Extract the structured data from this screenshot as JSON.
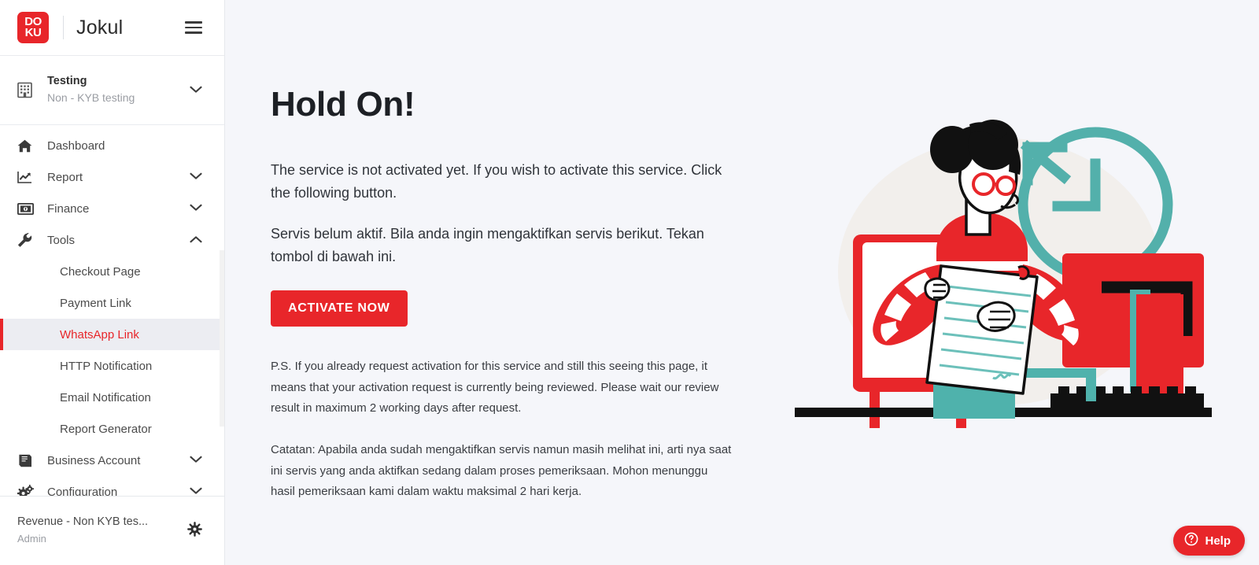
{
  "brand": {
    "logo_text_top": "DO",
    "logo_text_bottom": "KU",
    "logo_name": "doku-logo",
    "title": "Jokul",
    "menu_icon": "hamburger-icon"
  },
  "merchant": {
    "icon": "building-icon",
    "name": "Testing",
    "subtitle": "Non - KYB testing",
    "chevron": "chevron-down-icon"
  },
  "sidebar": {
    "items": [
      {
        "label": "Dashboard",
        "icon": "home-icon",
        "expandable": false
      },
      {
        "label": "Report",
        "icon": "trending-up-icon",
        "expandable": true,
        "chevron": "chevron-down-icon"
      },
      {
        "label": "Finance",
        "icon": "banknote-icon",
        "expandable": true,
        "chevron": "chevron-down-icon"
      },
      {
        "label": "Tools",
        "icon": "wrench-icon",
        "expandable": true,
        "chevron": "chevron-up-icon"
      }
    ],
    "tools_children": [
      {
        "label": "Checkout Page",
        "active": false
      },
      {
        "label": "Payment Link",
        "active": false
      },
      {
        "label": "WhatsApp Link",
        "active": true
      },
      {
        "label": "HTTP Notification",
        "active": false
      },
      {
        "label": "Email Notification",
        "active": false
      },
      {
        "label": "Report Generator",
        "active": false
      }
    ],
    "items_after": [
      {
        "label": "Business Account",
        "icon": "book-icon",
        "expandable": true,
        "chevron": "chevron-down-icon"
      },
      {
        "label": "Configuration",
        "icon": "cogs-icon",
        "expandable": true,
        "chevron": "chevron-down-icon"
      }
    ]
  },
  "sidebar_footer": {
    "account_name": "Revenue - Non KYB tes...",
    "role": "Admin",
    "settings_icon": "gear-icon"
  },
  "main": {
    "title": "Hold On!",
    "paragraph_en": "The service is not activated yet. If you wish to activate this service. Click the following button.",
    "paragraph_id": "Servis belum aktif. Bila anda ingin mengaktifkan servis berikut. Tekan tombol di bawah ini.",
    "activate_button": "ACTIVATE NOW",
    "ps_note_en": "P.S. If you already request activation for this service and still this seeing this page, it means that your activation request is currently being reviewed. Please wait our review result in maximum 2 working days after request.",
    "ps_note_id": "Catatan: Apabila anda sudah mengaktifkan servis namun masih melihat ini, arti nya saat ini servis yang anda aktifkan sedang dalam proses pemeriksaan. Mohon menunggu hasil pemeriksaan kami dalam waktu maksimal 2 hari kerja.",
    "illustration": "woman-reading-document-at-desk-with-clock-illustration"
  },
  "help_widget": {
    "icon": "question-circle-icon",
    "label": "Help"
  },
  "colors": {
    "brand_red": "#e8262a",
    "active_bg": "#ecedf2",
    "content_bg": "#f5f6fa",
    "sidebar_bg": "#ffffff",
    "teal_accent": "#5ab3ad",
    "text_dark": "#1d2025",
    "text_muted": "#9a9da3"
  }
}
